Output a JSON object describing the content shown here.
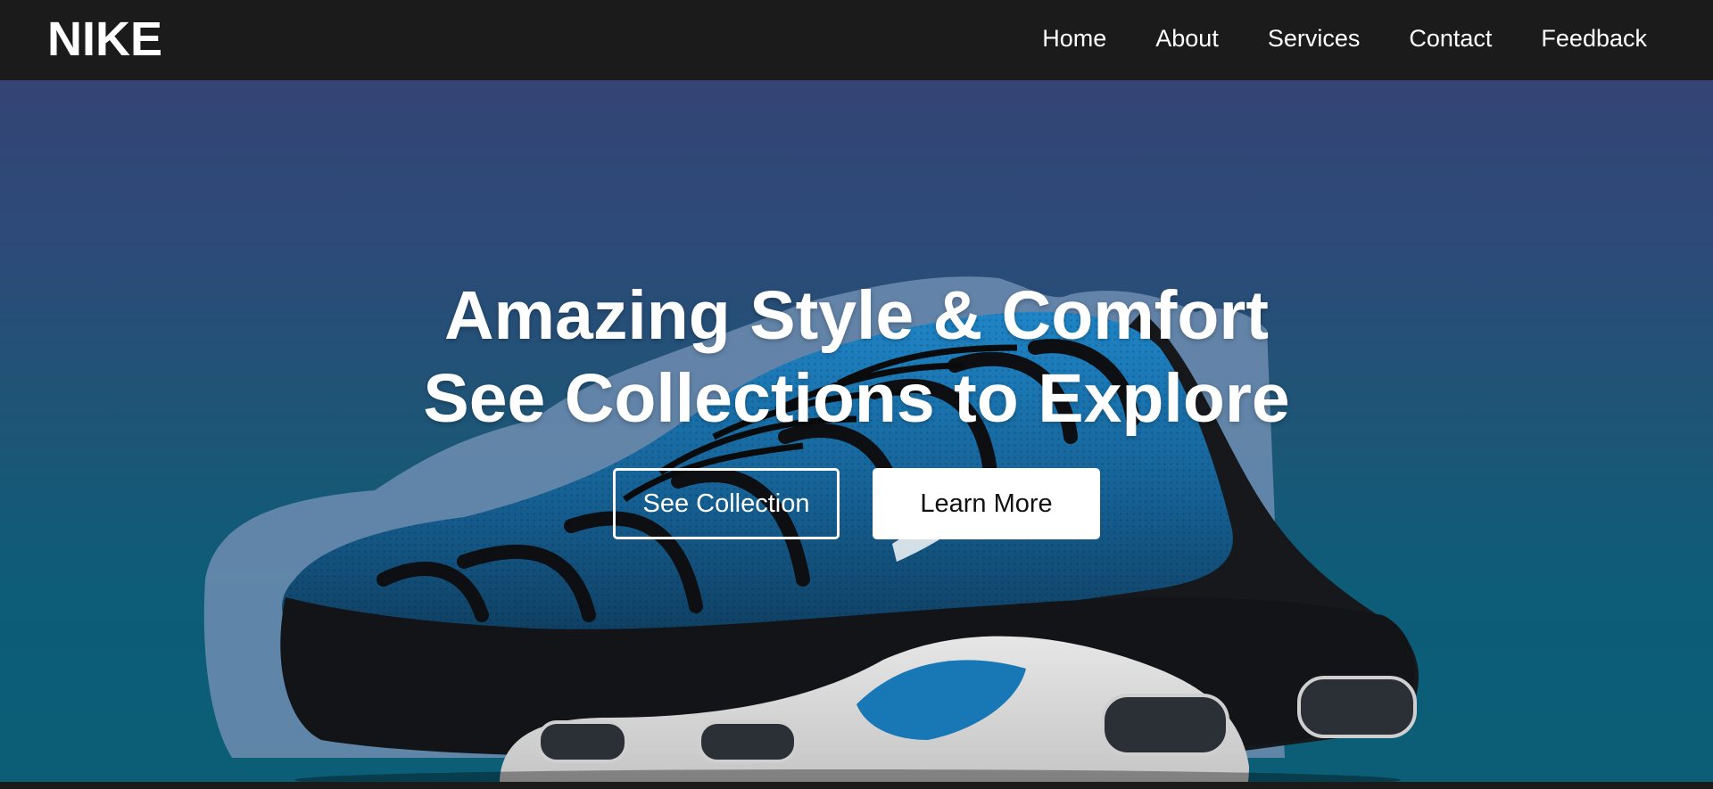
{
  "navbar": {
    "brand": "NIKE",
    "links": [
      {
        "label": "Home"
      },
      {
        "label": "About"
      },
      {
        "label": "Services"
      },
      {
        "label": "Contact"
      },
      {
        "label": "Feedback"
      }
    ]
  },
  "hero": {
    "headline_line1": "Amazing Style & Comfort",
    "headline_line2": "See Collections to Explore",
    "primary_button": "See Collection",
    "secondary_button": "Learn More",
    "image_icon": "sneaker-image"
  },
  "colors": {
    "navbar_bg": "#1b1b1b",
    "hero_top": "#344475",
    "hero_bottom": "#0b5e76",
    "text": "#ffffff",
    "shoe_blue": "#1b74b4",
    "shoe_black": "#1a1c20",
    "sole_white": "#d9d9d9"
  }
}
